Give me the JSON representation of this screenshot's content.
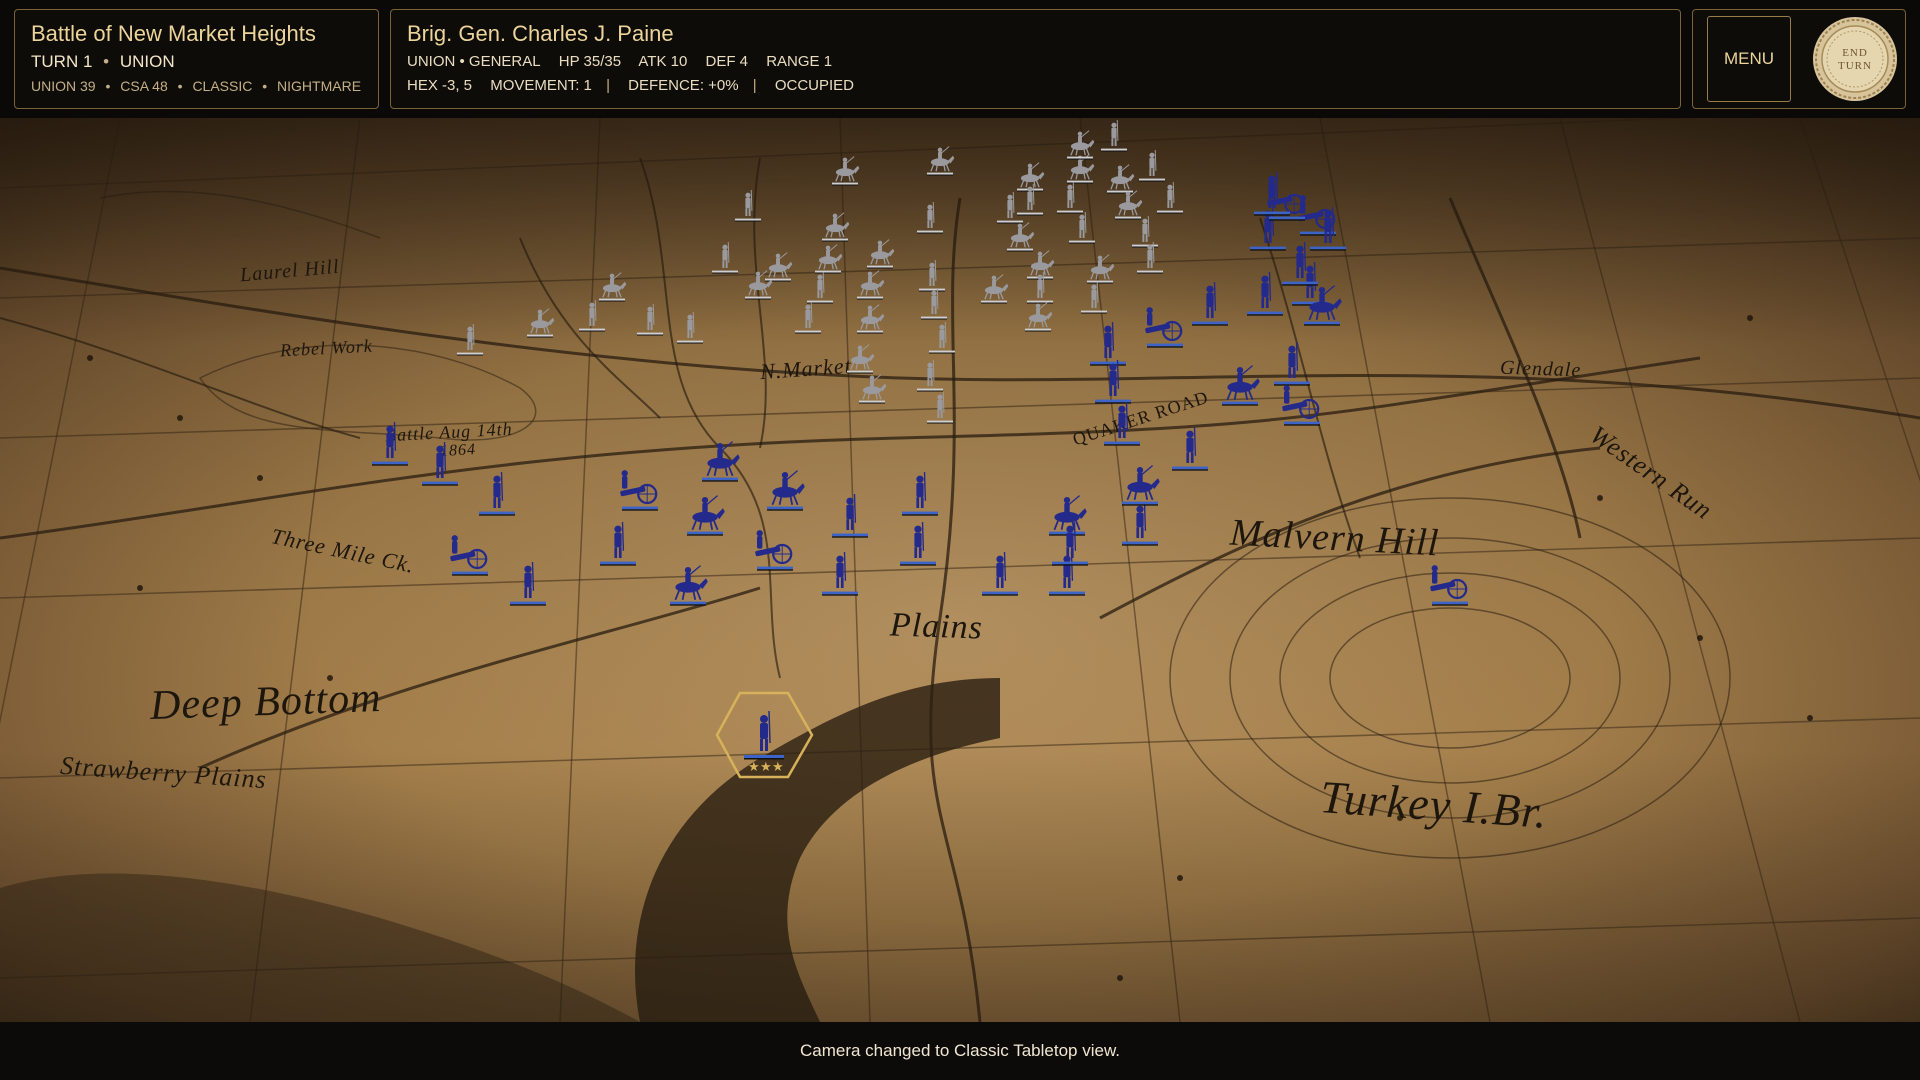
{
  "battle": {
    "title": "Battle of New Market Heights",
    "turn_label": "TURN 1",
    "side": "UNION",
    "union_count": "UNION 39",
    "csa_count": "CSA 48",
    "camera_mode": "CLASSIC",
    "difficulty": "NIGHTMARE"
  },
  "unit": {
    "name": "Brig. Gen. Charles J. Paine",
    "role": "UNION • GENERAL",
    "hp": "HP 35/35",
    "atk": "ATK 10",
    "def": "DEF 4",
    "range": "RANGE 1",
    "hex": "HEX -3, 5",
    "movement": "MOVEMENT: 1",
    "defence": "DEFENCE: +0%",
    "occupancy": "OCCUPIED",
    "star_rank": 3
  },
  "controls": {
    "menu_label": "MENU",
    "end_turn_line1": "END",
    "end_turn_line2": "TURN"
  },
  "map": {
    "labels": {
      "deep_bottom": "Deep Bottom",
      "plains": "Plains",
      "strawberry_plains": "Strawberry Plains",
      "malvern_hill": "Malvern Hill",
      "turkey_bridge": "Turkey I.Br.",
      "laurel_hill": "Laurel Hill",
      "rebel_work": "Rebel Work",
      "battle_aug": "Battle Aug 14th",
      "battle_year": "1864",
      "new_market": "N.Market",
      "glendale": "Glendale",
      "quaker_road": "QUAKER ROAD",
      "western_run": "Western Run",
      "three_mile_ck": "Three Mile Ck."
    },
    "colors": {
      "parchment_light": "#b08a55",
      "parchment_dark": "#3a2a17",
      "union": "#232a8c",
      "confederate": "#9a9a9e",
      "selection": "#d7b25a"
    }
  },
  "status": {
    "message": "Camera changed to Classic Tabletop view."
  }
}
